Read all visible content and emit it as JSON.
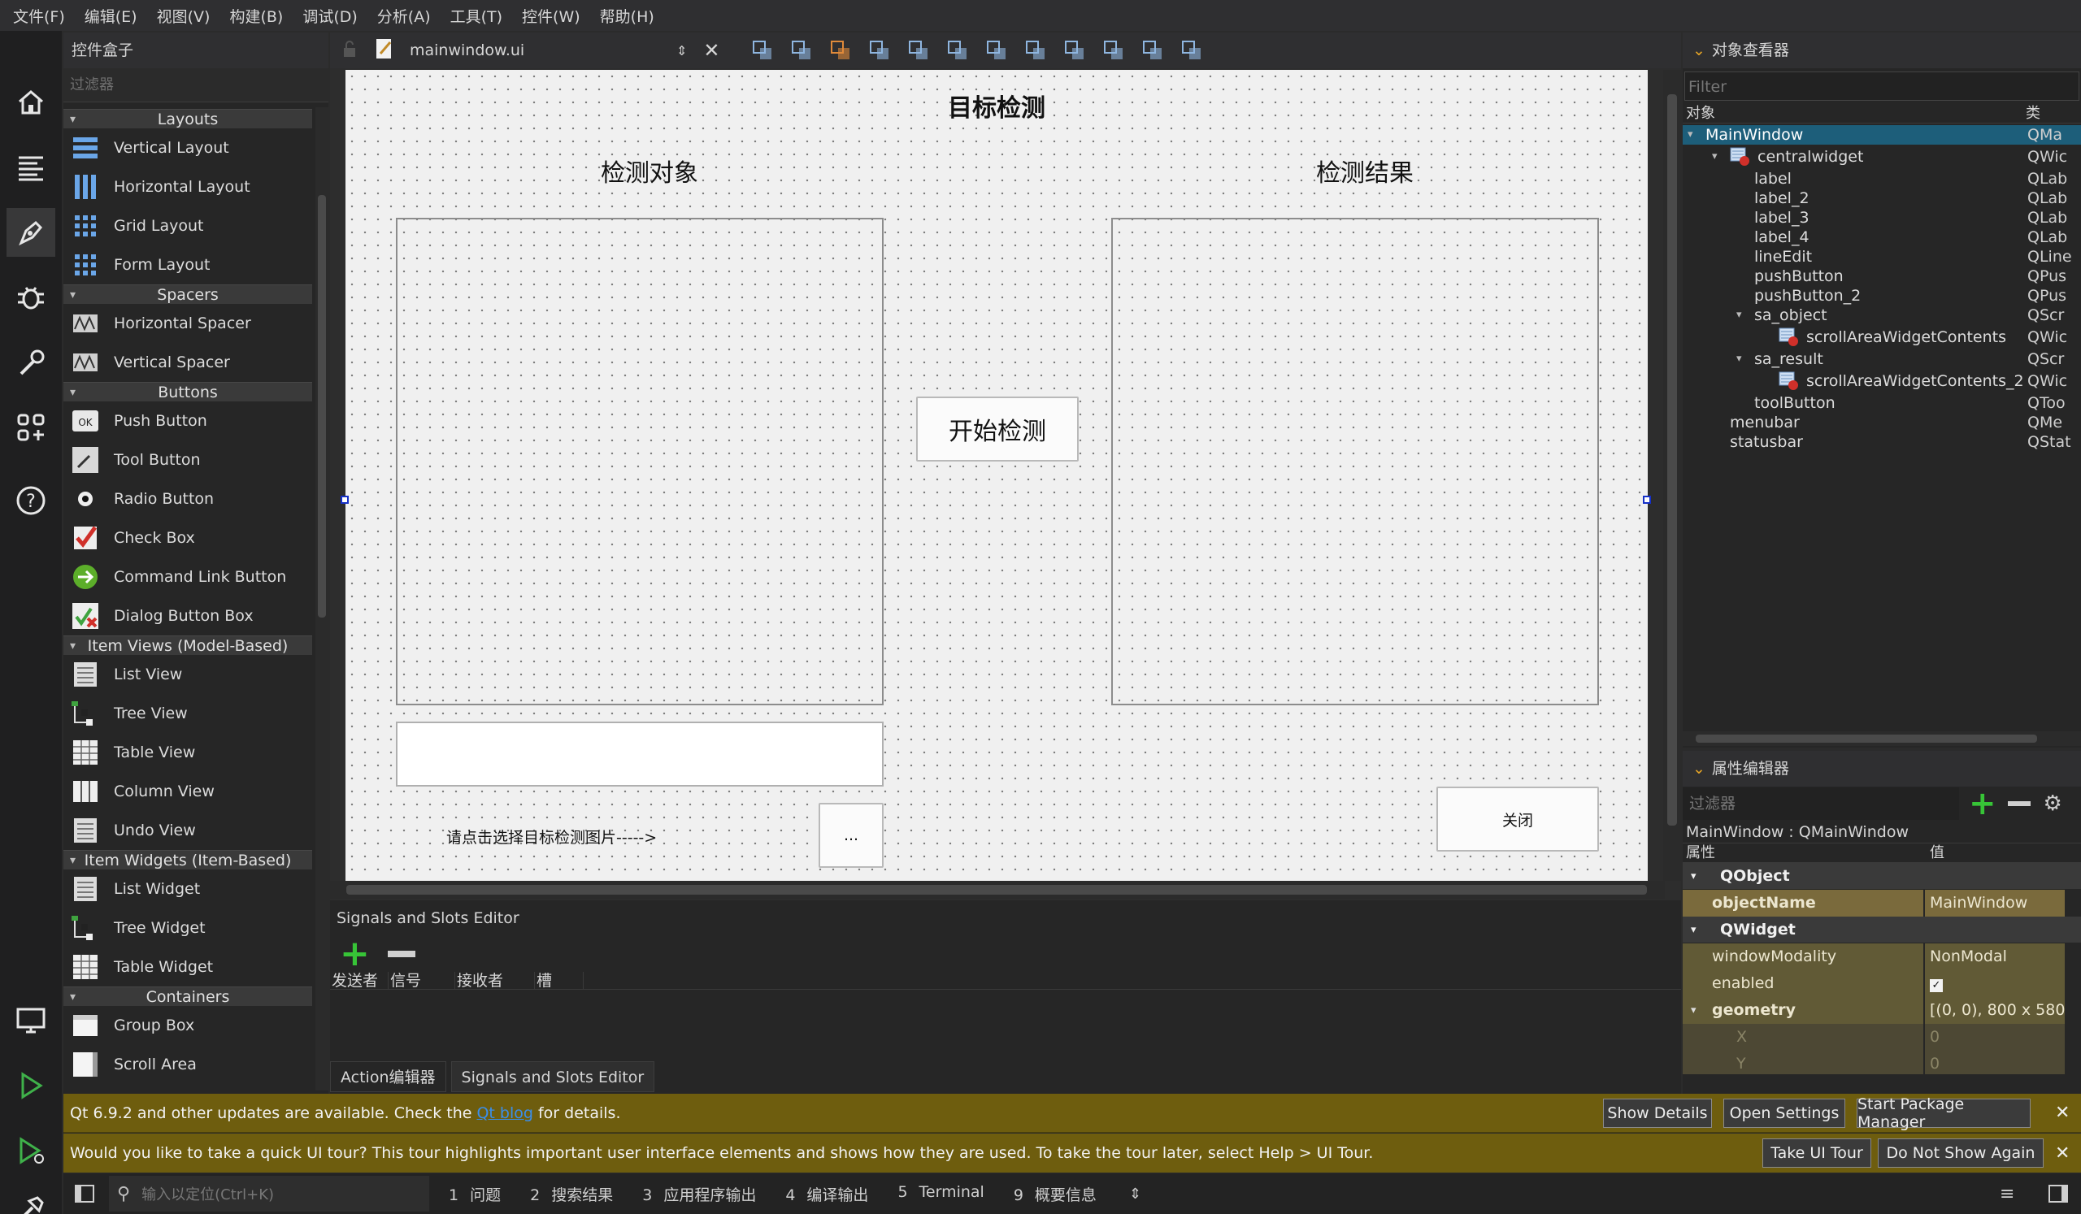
{
  "menubar": [
    "文件(F)",
    "编辑(E)",
    "视图(V)",
    "构建(B)",
    "调试(D)",
    "分析(A)",
    "工具(T)",
    "控件(W)",
    "帮助(H)"
  ],
  "modes": [
    {
      "name": "home-icon",
      "label": "Welcome"
    },
    {
      "name": "edit-icon",
      "label": "Edit"
    },
    {
      "name": "design-icon",
      "label": "Design"
    },
    {
      "name": "debug-icon",
      "label": "Debug"
    },
    {
      "name": "projects-icon",
      "label": "Projects"
    },
    {
      "name": "extensions-icon",
      "label": "Extensions"
    },
    {
      "name": "help-icon",
      "label": "Help"
    }
  ],
  "widgetbox": {
    "title": "控件盒子",
    "filter_placeholder": "过滤器",
    "categories": [
      {
        "name": "Layouts",
        "items": [
          "Vertical Layout",
          "Horizontal Layout",
          "Grid Layout",
          "Form Layout"
        ]
      },
      {
        "name": "Spacers",
        "items": [
          "Horizontal Spacer",
          "Vertical Spacer"
        ]
      },
      {
        "name": "Buttons",
        "items": [
          "Push Button",
          "Tool Button",
          "Radio Button",
          "Check Box",
          "Command Link Button",
          "Dialog Button Box"
        ]
      },
      {
        "name": "Item Views (Model-Based)",
        "items": [
          "List View",
          "Tree View",
          "Table View",
          "Column View",
          "Undo View"
        ]
      },
      {
        "name": "Item Widgets (Item-Based)",
        "items": [
          "List Widget",
          "Tree Widget",
          "Table Widget"
        ]
      },
      {
        "name": "Containers",
        "items": [
          "Group Box",
          "Scroll Area"
        ]
      }
    ]
  },
  "editor": {
    "file_name": "mainwindow.ui"
  },
  "form": {
    "title": "目标检测",
    "label_object": "检测对象",
    "label_result": "检测结果",
    "start_button": "开始检测",
    "hint": "请点击选择目标检测图片----->",
    "browse_button": "...",
    "close_button": "关闭"
  },
  "signals": {
    "title": "Signals and Slots Editor",
    "columns": [
      "发送者",
      "信号",
      "接收者",
      "槽"
    ],
    "tabs": [
      "Action编辑器",
      "Signals and Slots Editor"
    ]
  },
  "object_inspector": {
    "title": "对象查看器",
    "filter_placeholder": "Filter",
    "col_object": "对象",
    "col_class": "类",
    "rows": [
      {
        "name": "MainWindow",
        "cls": "QMa",
        "level": 0,
        "expand": true,
        "selected": true,
        "icon": false
      },
      {
        "name": "centralwidget",
        "cls": "QWic",
        "level": 1,
        "expand": true,
        "selected": false,
        "icon": true
      },
      {
        "name": "label",
        "cls": "QLab",
        "level": 2,
        "expand": false,
        "selected": false,
        "icon": false
      },
      {
        "name": "label_2",
        "cls": "QLab",
        "level": 2,
        "expand": false,
        "selected": false,
        "icon": false
      },
      {
        "name": "label_3",
        "cls": "QLab",
        "level": 2,
        "expand": false,
        "selected": false,
        "icon": false
      },
      {
        "name": "label_4",
        "cls": "QLab",
        "level": 2,
        "expand": false,
        "selected": false,
        "icon": false
      },
      {
        "name": "lineEdit",
        "cls": "QLine",
        "level": 2,
        "expand": false,
        "selected": false,
        "icon": false
      },
      {
        "name": "pushButton",
        "cls": "QPus",
        "level": 2,
        "expand": false,
        "selected": false,
        "icon": false
      },
      {
        "name": "pushButton_2",
        "cls": "QPus",
        "level": 2,
        "expand": false,
        "selected": false,
        "icon": false
      },
      {
        "name": "sa_object",
        "cls": "QScr",
        "level": 2,
        "expand": true,
        "selected": false,
        "icon": false
      },
      {
        "name": "scrollAreaWidgetContents",
        "cls": "QWic",
        "level": 3,
        "expand": false,
        "selected": false,
        "icon": true
      },
      {
        "name": "sa_result",
        "cls": "QScr",
        "level": 2,
        "expand": true,
        "selected": false,
        "icon": false
      },
      {
        "name": "scrollAreaWidgetContents_2",
        "cls": "QWic",
        "level": 3,
        "expand": false,
        "selected": false,
        "icon": true
      },
      {
        "name": "toolButton",
        "cls": "QToo",
        "level": 2,
        "expand": false,
        "selected": false,
        "icon": false
      },
      {
        "name": "menubar",
        "cls": "QMe",
        "level": 1,
        "expand": false,
        "selected": false,
        "icon": false
      },
      {
        "name": "statusbar",
        "cls": "QStat",
        "level": 1,
        "expand": false,
        "selected": false,
        "icon": false
      }
    ]
  },
  "property_editor": {
    "title": "属性编辑器",
    "filter_placeholder": "过滤器",
    "context": "MainWindow : QMainWindow",
    "col_property": "属性",
    "col_value": "值",
    "rows": [
      {
        "type": "group",
        "key": "QObject"
      },
      {
        "type": "prop",
        "key": "objectName",
        "value": "MainWindow",
        "bold": true,
        "color": "#7a6a3c"
      },
      {
        "type": "group",
        "key": "QWidget"
      },
      {
        "type": "prop",
        "key": "windowModality",
        "value": "NonModal",
        "bold": false,
        "color": "#615a36"
      },
      {
        "type": "prop",
        "key": "enabled",
        "value": "",
        "bold": false,
        "color": "#615a36",
        "checkbox": true
      },
      {
        "type": "prop",
        "key": "geometry",
        "value": "[(0, 0), 800 x 580]",
        "bold": true,
        "color": "#615a36",
        "expand": true
      },
      {
        "type": "prop",
        "key": "X",
        "value": "0",
        "bold": false,
        "color": "#4d4834",
        "dim": true
      },
      {
        "type": "prop",
        "key": "Y",
        "value": "0",
        "bold": false,
        "color": "#4d4834",
        "dim": true
      }
    ]
  },
  "notifications": [
    {
      "text_before": "Qt 6.9.2 and other updates are available. Check the ",
      "link": "Qt blog",
      "text_after": " for details.",
      "buttons": [
        "Show Details",
        "Open Settings",
        "Start Package Manager"
      ]
    },
    {
      "text_before": "Would you like to take a quick UI tour? This tour highlights important user interface elements and shows how they are used. To take the tour later, select Help > UI Tour.",
      "link": "",
      "text_after": "",
      "buttons": [
        "Take UI Tour",
        "Do Not Show Again"
      ]
    }
  ],
  "statusbar": {
    "locator_placeholder": "输入以定位(Ctrl+K)",
    "panes": [
      {
        "num": "1",
        "label": "问题"
      },
      {
        "num": "2",
        "label": "搜索结果"
      },
      {
        "num": "3",
        "label": "应用程序输出"
      },
      {
        "num": "4",
        "label": "编译输出"
      },
      {
        "num": "5",
        "label": "Terminal"
      },
      {
        "num": "9",
        "label": "概要信息"
      }
    ]
  },
  "colors": {
    "accent": "#1d5e7a",
    "notification": "#6e5d0e",
    "link": "#3b8eea"
  }
}
